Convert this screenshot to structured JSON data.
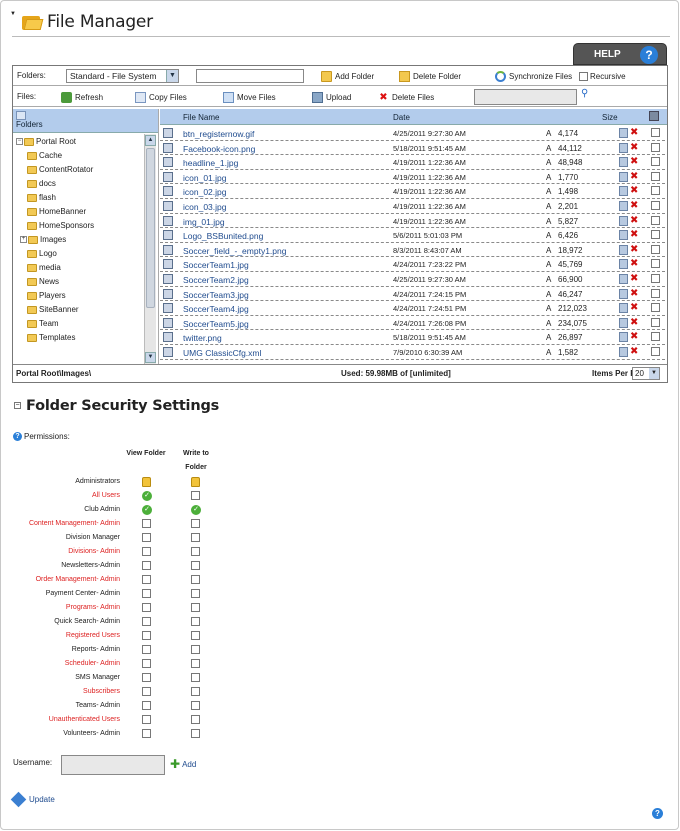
{
  "page": {
    "title": "File Manager",
    "help_label": "HELP"
  },
  "toolbar1": {
    "folders_label": "Folders:",
    "folder_select": "Standard - File System",
    "add_folder": "Add Folder",
    "delete_folder": "Delete Folder",
    "sync_files": "Synchronize Files",
    "recursive": "Recursive"
  },
  "toolbar2": {
    "files_label": "Files:",
    "refresh": "Refresh",
    "copy_files": "Copy Files",
    "move_files": "Move Files",
    "upload": "Upload",
    "delete_files": "Delete Files"
  },
  "tree": {
    "header": "Folders",
    "items": [
      {
        "label": "Portal Root",
        "level": 0
      },
      {
        "label": "Cache",
        "level": 1
      },
      {
        "label": "ContentRotator",
        "level": 1
      },
      {
        "label": "docs",
        "level": 1
      },
      {
        "label": "flash",
        "level": 1
      },
      {
        "label": "HomeBanner",
        "level": 1
      },
      {
        "label": "HomeSponsors",
        "level": 1
      },
      {
        "label": "Images",
        "level": 1
      },
      {
        "label": "Logo",
        "level": 1
      },
      {
        "label": "media",
        "level": 1
      },
      {
        "label": "News",
        "level": 1
      },
      {
        "label": "Players",
        "level": 1
      },
      {
        "label": "SiteBanner",
        "level": 1
      },
      {
        "label": "Team",
        "level": 1
      },
      {
        "label": "Templates",
        "level": 1
      }
    ]
  },
  "grid": {
    "headers": {
      "name": "File Name",
      "date": "Date",
      "size": "Size"
    },
    "rows": [
      {
        "name": "btn_registernow.gif",
        "date": "4/25/2011 9:27:30 AM",
        "attr": "A",
        "size": "4,174"
      },
      {
        "name": "Facebook-icon.png",
        "date": "5/18/2011 9:51:45 AM",
        "attr": "A",
        "size": "44,112"
      },
      {
        "name": "headline_1.jpg",
        "date": "4/19/2011 1:22:36 AM",
        "attr": "A",
        "size": "48,948"
      },
      {
        "name": "icon_01.jpg",
        "date": "4/19/2011 1:22:36 AM",
        "attr": "A",
        "size": "1,770"
      },
      {
        "name": "icon_02.jpg",
        "date": "4/19/2011 1:22:36 AM",
        "attr": "A",
        "size": "1,498"
      },
      {
        "name": "icon_03.jpg",
        "date": "4/19/2011 1:22:36 AM",
        "attr": "A",
        "size": "2,201"
      },
      {
        "name": "img_01.jpg",
        "date": "4/19/2011 1:22:36 AM",
        "attr": "A",
        "size": "5,827"
      },
      {
        "name": "Logo_BSBunited.png",
        "date": "5/6/2011 5:01:03 PM",
        "attr": "A",
        "size": "6,426"
      },
      {
        "name": "Soccer_field_-_empty1.png",
        "date": "8/3/2011 8:43:07 AM",
        "attr": "A",
        "size": "18,972"
      },
      {
        "name": "SoccerTeam1.jpg",
        "date": "4/24/2011 7:23:22 PM",
        "attr": "A",
        "size": "45,769"
      },
      {
        "name": "SoccerTeam2.jpg",
        "date": "4/25/2011 9:27:30 AM",
        "attr": "A",
        "size": "66,900"
      },
      {
        "name": "SoccerTeam3.jpg",
        "date": "4/24/2011 7:24:15 PM",
        "attr": "A",
        "size": "46,247"
      },
      {
        "name": "SoccerTeam4.jpg",
        "date": "4/24/2011 7:24:51 PM",
        "attr": "A",
        "size": "212,023"
      },
      {
        "name": "SoccerTeam5.jpg",
        "date": "4/24/2011 7:26:08 PM",
        "attr": "A",
        "size": "234,075"
      },
      {
        "name": "twitter.png",
        "date": "5/18/2011 9:51:45 AM",
        "attr": "A",
        "size": "26,897"
      },
      {
        "name": "UMG ClassicCfg.xml",
        "date": "7/9/2010 6:30:39 AM",
        "attr": "A",
        "size": "1,582"
      }
    ]
  },
  "status": {
    "path": "Portal Root\\Images\\",
    "used": "Used: 59.98MB of [unlimited]",
    "items_per_page_label": "Items Per Page:",
    "items_per_page": "20"
  },
  "security": {
    "title": "Folder Security Settings",
    "permissions_label": "Permissions:",
    "col_view": "View Folder",
    "col_write1": "Write to",
    "col_write2": "Folder",
    "roles": [
      {
        "name": "Administrators",
        "red": false,
        "view": "lock",
        "write": "lock"
      },
      {
        "name": "All Users",
        "red": true,
        "view": "check",
        "write": "box"
      },
      {
        "name": "Club Admin",
        "red": false,
        "view": "check",
        "write": "check"
      },
      {
        "name": "Content Management- Admin",
        "red": true,
        "view": "box",
        "write": "box"
      },
      {
        "name": "Division Manager",
        "red": false,
        "view": "box",
        "write": "box"
      },
      {
        "name": "Divisions- Admin",
        "red": true,
        "view": "box",
        "write": "box"
      },
      {
        "name": "Newsletters-Admin",
        "red": false,
        "view": "box",
        "write": "box"
      },
      {
        "name": "Order Management- Admin",
        "red": true,
        "view": "box",
        "write": "box"
      },
      {
        "name": "Payment Center- Admin",
        "red": false,
        "view": "box",
        "write": "box"
      },
      {
        "name": "Programs- Admin",
        "red": true,
        "view": "box",
        "write": "box"
      },
      {
        "name": "Quick Search- Admin",
        "red": false,
        "view": "box",
        "write": "box"
      },
      {
        "name": "Registered Users",
        "red": true,
        "view": "box",
        "write": "box"
      },
      {
        "name": "Reports- Admin",
        "red": false,
        "view": "box",
        "write": "box"
      },
      {
        "name": "Scheduler- Admin",
        "red": true,
        "view": "box",
        "write": "box"
      },
      {
        "name": "SMS Manager",
        "red": false,
        "view": "box",
        "write": "box"
      },
      {
        "name": "Subscribers",
        "red": true,
        "view": "box",
        "write": "box"
      },
      {
        "name": "Teams- Admin",
        "red": false,
        "view": "box",
        "write": "box"
      },
      {
        "name": "Unauthenticated Users",
        "red": true,
        "view": "box",
        "write": "box"
      },
      {
        "name": "Volunteers- Admin",
        "red": false,
        "view": "box",
        "write": "box"
      }
    ],
    "username_label": "Username:",
    "add_label": "Add",
    "update_label": "Update"
  }
}
